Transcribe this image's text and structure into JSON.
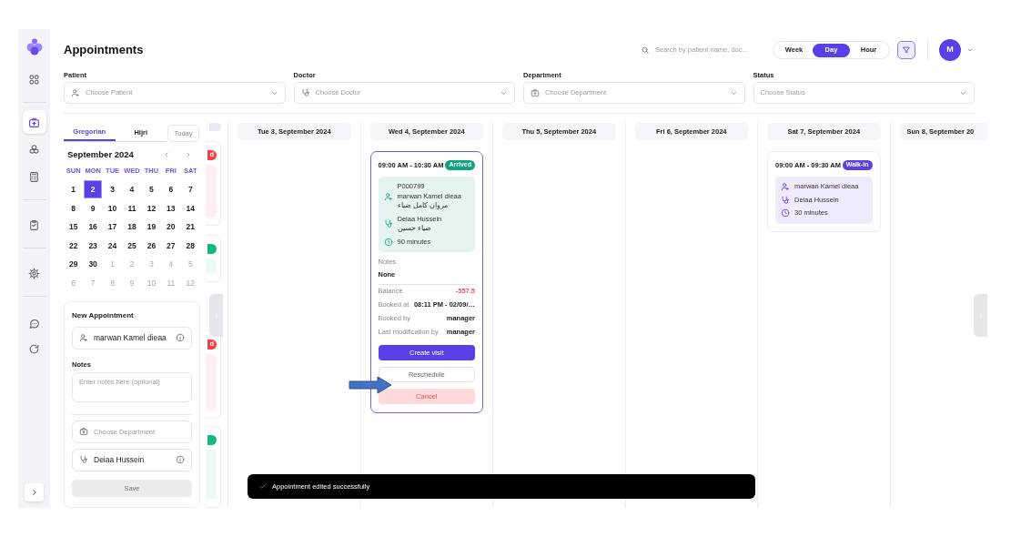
{
  "sidebar": {
    "items": [
      {
        "selected": false
      },
      {
        "selected": true
      },
      {
        "selected": false
      },
      {
        "selected": false
      },
      {
        "selected": false
      },
      {
        "selected": false
      },
      {
        "selected": false
      },
      {
        "selected": false
      }
    ]
  },
  "header": {
    "title": "Appointments",
    "search": {
      "placeholder": "Search by patient name, doc..."
    },
    "views": [
      {
        "label": "Week",
        "selected": false
      },
      {
        "label": "Day",
        "selected": true
      },
      {
        "label": "Hour",
        "selected": false
      }
    ],
    "avatar": "M"
  },
  "filters": [
    {
      "label": "Patient",
      "placeholder": "Choose Patient"
    },
    {
      "label": "Doctor",
      "placeholder": "Choose Doctor"
    },
    {
      "label": "Department",
      "placeholder": "Choose Department"
    },
    {
      "label": "Status",
      "placeholder": "Choose Status"
    }
  ],
  "calendar": {
    "tabs": [
      {
        "label": "Gregorian",
        "selected": true
      },
      {
        "label": "Hijri",
        "selected": false
      }
    ],
    "today": "Today",
    "month": "September 2024",
    "weekdays": [
      "SUN",
      "MON",
      "TUE",
      "WED",
      "THU",
      "FRI",
      "SAT"
    ],
    "days": [
      {
        "label": "1",
        "outside": false,
        "selected": false
      },
      {
        "label": "2",
        "outside": false,
        "selected": true
      },
      {
        "label": "3",
        "outside": false,
        "selected": false
      },
      {
        "label": "4",
        "outside": false,
        "selected": false
      },
      {
        "label": "5",
        "outside": false,
        "selected": false
      },
      {
        "label": "6",
        "outside": false,
        "selected": false
      },
      {
        "label": "7",
        "outside": false,
        "selected": false
      },
      {
        "label": "8",
        "outside": false,
        "selected": false
      },
      {
        "label": "9",
        "outside": false,
        "selected": false
      },
      {
        "label": "10",
        "outside": false,
        "selected": false
      },
      {
        "label": "11",
        "outside": false,
        "selected": false
      },
      {
        "label": "12",
        "outside": false,
        "selected": false
      },
      {
        "label": "13",
        "outside": false,
        "selected": false
      },
      {
        "label": "14",
        "outside": false,
        "selected": false
      },
      {
        "label": "15",
        "outside": false,
        "selected": false
      },
      {
        "label": "16",
        "outside": false,
        "selected": false
      },
      {
        "label": "17",
        "outside": false,
        "selected": false
      },
      {
        "label": "18",
        "outside": false,
        "selected": false
      },
      {
        "label": "19",
        "outside": false,
        "selected": false
      },
      {
        "label": "20",
        "outside": false,
        "selected": false
      },
      {
        "label": "21",
        "outside": false,
        "selected": false
      },
      {
        "label": "22",
        "outside": false,
        "selected": false
      },
      {
        "label": "23",
        "outside": false,
        "selected": false
      },
      {
        "label": "24",
        "outside": false,
        "selected": false
      },
      {
        "label": "25",
        "outside": false,
        "selected": false
      },
      {
        "label": "26",
        "outside": false,
        "selected": false
      },
      {
        "label": "27",
        "outside": false,
        "selected": false
      },
      {
        "label": "28",
        "outside": false,
        "selected": false
      },
      {
        "label": "29",
        "outside": false,
        "selected": false
      },
      {
        "label": "30",
        "outside": false,
        "selected": false
      },
      {
        "label": "1",
        "outside": true,
        "selected": false
      },
      {
        "label": "2",
        "outside": true,
        "selected": false
      },
      {
        "label": "3",
        "outside": true,
        "selected": false
      },
      {
        "label": "4",
        "outside": true,
        "selected": false
      },
      {
        "label": "5",
        "outside": true,
        "selected": false
      },
      {
        "label": "6",
        "outside": true,
        "selected": false
      },
      {
        "label": "7",
        "outside": true,
        "selected": false
      },
      {
        "label": "8",
        "outside": true,
        "selected": false
      },
      {
        "label": "9",
        "outside": true,
        "selected": false
      },
      {
        "label": "10",
        "outside": true,
        "selected": false
      },
      {
        "label": "11",
        "outside": true,
        "selected": false
      },
      {
        "label": "12",
        "outside": true,
        "selected": false
      }
    ]
  },
  "new_appointment": {
    "title": "New Appointment",
    "patient": "marwan Kamel dieaa",
    "notes_label": "Notes",
    "notes_placeholder": "Enter notes here (optional)",
    "department_placeholder": "Choose Department",
    "doctor": "Deiaa Hussein",
    "save": "Save"
  },
  "partial_column": {
    "cards": [
      {
        "status": "d",
        "color": "#ef4444"
      },
      {
        "color": "#10b981"
      },
      {
        "status": "d",
        "color": "#ef4444"
      },
      {
        "color": "#10b981"
      }
    ]
  },
  "day_columns": [
    {
      "header": "Tue 3, September 2024"
    },
    {
      "header": "Wed 4, September 2024",
      "appointments": [
        {
          "kind": "arrived",
          "selected": true,
          "time": "09:00 AM - 10:30 AM",
          "status": "Arrived",
          "patient_id": "P000799",
          "patient": "marwan Kamel dieaa",
          "patient_ar": "مروان كامل ضياء",
          "doctor": "Deiaa Hussein",
          "doctor_ar": "ضياء حسين",
          "duration": "90 minutes",
          "notes_label": "Notes",
          "notes": "None",
          "details": [
            {
              "label": "Balance",
              "value": "-557.5",
              "negative": true
            },
            {
              "label": "Booked at",
              "value": "08:11 PM - 02/09/…",
              "negative": false
            },
            {
              "label": "Booked by",
              "value": "manager",
              "negative": false
            },
            {
              "label": "Last modification by",
              "value": "manager",
              "negative": false
            }
          ],
          "actions": [
            {
              "label": "Create visit",
              "kind": "primary"
            },
            {
              "label": "Reschedule",
              "kind": "outline"
            },
            {
              "label": "Cancel",
              "kind": "danger"
            }
          ]
        }
      ]
    },
    {
      "header": "Thu 5, September 2024"
    },
    {
      "header": "Fri 6, September 2024"
    },
    {
      "header": "Sat 7, September 2024",
      "appointments": [
        {
          "kind": "walk-in",
          "selected": false,
          "time": "09:00 AM - 09:30 AM",
          "status": "Walk-in",
          "patient": "marwan Kamel dieaa",
          "doctor": "Deiaa Hussein",
          "duration": "30 minutes"
        }
      ]
    },
    {
      "header": "Sun 8, September 20"
    }
  ],
  "toast": {
    "message": "Appointment edited successfully"
  }
}
